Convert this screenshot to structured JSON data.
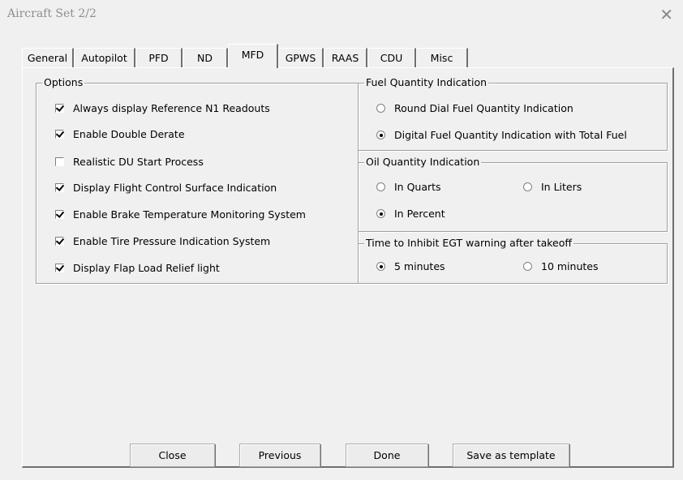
{
  "window": {
    "title": "Aircraft Set 2/2",
    "close_glyph": "✕"
  },
  "tabs": [
    {
      "label": "General",
      "active": false
    },
    {
      "label": "Autopilot",
      "active": false
    },
    {
      "label": "PFD",
      "active": false
    },
    {
      "label": "ND",
      "active": false
    },
    {
      "label": "MFD",
      "active": true
    },
    {
      "label": "GPWS",
      "active": false
    },
    {
      "label": "RAAS",
      "active": false
    },
    {
      "label": "CDU",
      "active": false
    },
    {
      "label": "Misc",
      "active": false
    }
  ],
  "options_group": {
    "title": "Options",
    "items": [
      {
        "label": "Always display Reference N1 Readouts",
        "checked": true
      },
      {
        "label": "Enable Double Derate",
        "checked": true
      },
      {
        "label": "Realistic DU Start Process",
        "checked": false
      },
      {
        "label": "Display Flight Control Surface Indication",
        "checked": true
      },
      {
        "label": "Enable Brake Temperature Monitoring System",
        "checked": true
      },
      {
        "label": "Enable Tire Pressure Indication System",
        "checked": true
      },
      {
        "label": "Display Flap Load Relief light",
        "checked": true
      }
    ]
  },
  "fuel_group": {
    "title": "Fuel Quantity Indication",
    "items": [
      {
        "label": "Round Dial Fuel Quantity Indication",
        "selected": false
      },
      {
        "label": "Digital Fuel Quantity Indication with Total Fuel",
        "selected": true
      }
    ]
  },
  "oil_group": {
    "title": "Oil Quantity Indication",
    "items": [
      {
        "label": "In Quarts",
        "selected": false
      },
      {
        "label": "In Liters",
        "selected": false
      },
      {
        "label": "In Percent",
        "selected": true
      }
    ]
  },
  "egt_group": {
    "title": "Time to Inhibit EGT warning after takeoff",
    "items": [
      {
        "label": "5 minutes",
        "selected": true
      },
      {
        "label": "10 minutes",
        "selected": false
      }
    ]
  },
  "buttons": {
    "close": "Close",
    "previous": "Previous",
    "done": "Done",
    "save_template": "Save as template"
  }
}
